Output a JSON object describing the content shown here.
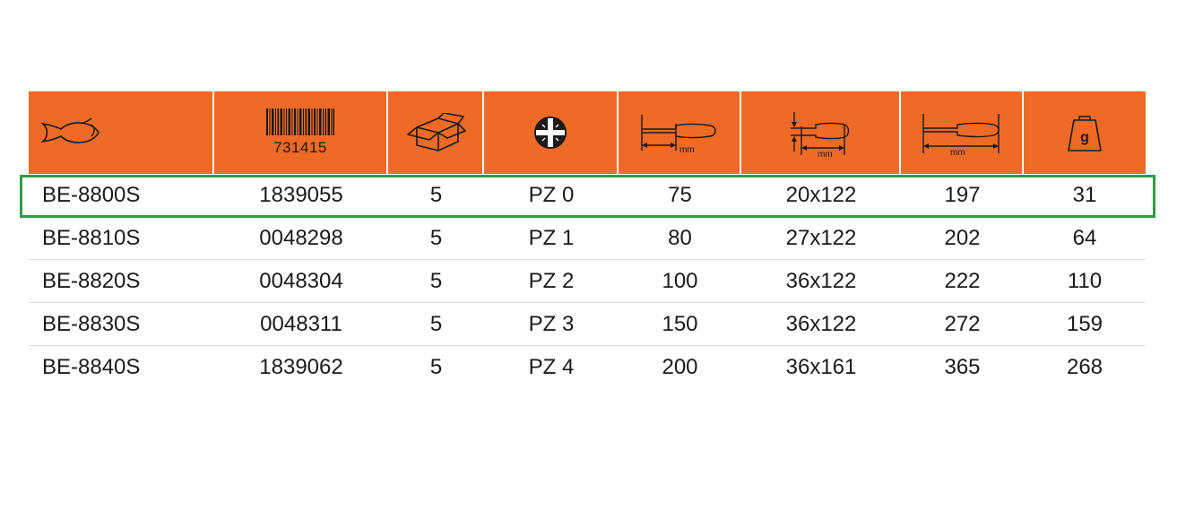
{
  "header": {
    "barcode_number": "731415",
    "unit_mm": "mm",
    "unit_g": "g",
    "icons": [
      "fish-icon",
      "barcode-icon",
      "box-icon",
      "pozidriv-tip-icon",
      "blade-length-icon",
      "tip-dimension-icon",
      "total-length-icon",
      "weight-icon"
    ]
  },
  "colors": {
    "header_background": "#ee6a26",
    "highlight_border": "#2e9e44"
  },
  "rows": [
    {
      "code": "BE-8800S",
      "ean": "1839055",
      "qty": "5",
      "tip": "PZ 0",
      "blade": "75",
      "tip_dim": "20x122",
      "length": "197",
      "weight": "31"
    },
    {
      "code": "BE-8810S",
      "ean": "0048298",
      "qty": "5",
      "tip": "PZ 1",
      "blade": "80",
      "tip_dim": "27x122",
      "length": "202",
      "weight": "64"
    },
    {
      "code": "BE-8820S",
      "ean": "0048304",
      "qty": "5",
      "tip": "PZ 2",
      "blade": "100",
      "tip_dim": "36x122",
      "length": "222",
      "weight": "110"
    },
    {
      "code": "BE-8830S",
      "ean": "0048311",
      "qty": "5",
      "tip": "PZ 3",
      "blade": "150",
      "tip_dim": "36x122",
      "length": "272",
      "weight": "159"
    },
    {
      "code": "BE-8840S",
      "ean": "1839062",
      "qty": "5",
      "tip": "PZ 4",
      "blade": "200",
      "tip_dim": "36x161",
      "length": "365",
      "weight": "268"
    }
  ]
}
